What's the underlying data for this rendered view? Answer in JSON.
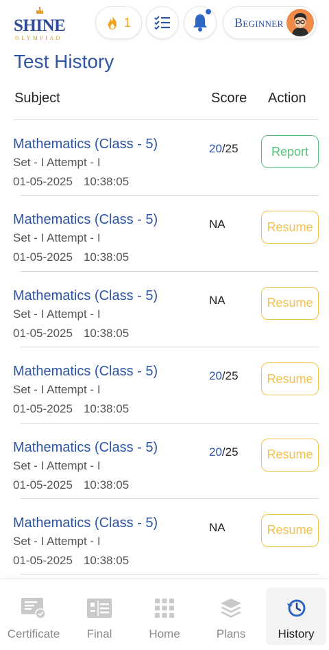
{
  "header": {
    "logo_text": "SHINE",
    "logo_subtext": "OLYMPIAD",
    "streak_count": "1",
    "level_label": "Beginner"
  },
  "page_title": "Test History",
  "table": {
    "columns": {
      "subject": "Subject",
      "score": "Score",
      "action": "Action"
    },
    "rows": [
      {
        "subject": "Mathematics (Class - 5)",
        "meta": "Set - I Attempt - I",
        "date": "01-05-2025",
        "time": "10:38:05",
        "score_got": "20",
        "score_total": "/25",
        "score_na": "",
        "action": "Report",
        "action_type": "report"
      },
      {
        "subject": "Mathematics (Class - 5)",
        "meta": "Set - I Attempt - I",
        "date": "01-05-2025",
        "time": "10:38:05",
        "score_got": "",
        "score_total": "",
        "score_na": "NA",
        "action": "Resume",
        "action_type": "resume"
      },
      {
        "subject": "Mathematics (Class - 5)",
        "meta": "Set - I Attempt - I",
        "date": "01-05-2025",
        "time": "10:38:05",
        "score_got": "",
        "score_total": "",
        "score_na": "NA",
        "action": "Resume",
        "action_type": "resume"
      },
      {
        "subject": "Mathematics (Class - 5)",
        "meta": "Set - I Attempt - I",
        "date": "01-05-2025",
        "time": "10:38:05",
        "score_got": "20",
        "score_total": "/25",
        "score_na": "",
        "action": "Resume",
        "action_type": "resume"
      },
      {
        "subject": "Mathematics (Class - 5)",
        "meta": "Set - I Attempt - I",
        "date": "01-05-2025",
        "time": "10:38:05",
        "score_got": "20",
        "score_total": "/25",
        "score_na": "",
        "action": "Resume",
        "action_type": "resume"
      },
      {
        "subject": "Mathematics (Class - 5)",
        "meta": "Set - I Attempt - I",
        "date": "01-05-2025",
        "time": "10:38:05",
        "score_got": "",
        "score_total": "",
        "score_na": "NA",
        "action": "Resume",
        "action_type": "resume"
      }
    ]
  },
  "bottom_nav": [
    {
      "label": "Certificate",
      "icon": "certificate-icon",
      "active": false
    },
    {
      "label": "Final",
      "icon": "final-icon",
      "active": false
    },
    {
      "label": "Home",
      "icon": "home-grid-icon",
      "active": false
    },
    {
      "label": "Plans",
      "icon": "plans-layers-icon",
      "active": false
    },
    {
      "label": "History",
      "icon": "history-clock-icon",
      "active": true
    }
  ],
  "colors": {
    "brand_blue": "#2d55a4",
    "report_green": "#55c27a",
    "resume_yellow": "#f2c14e",
    "streak_orange": "#f0a21b"
  }
}
